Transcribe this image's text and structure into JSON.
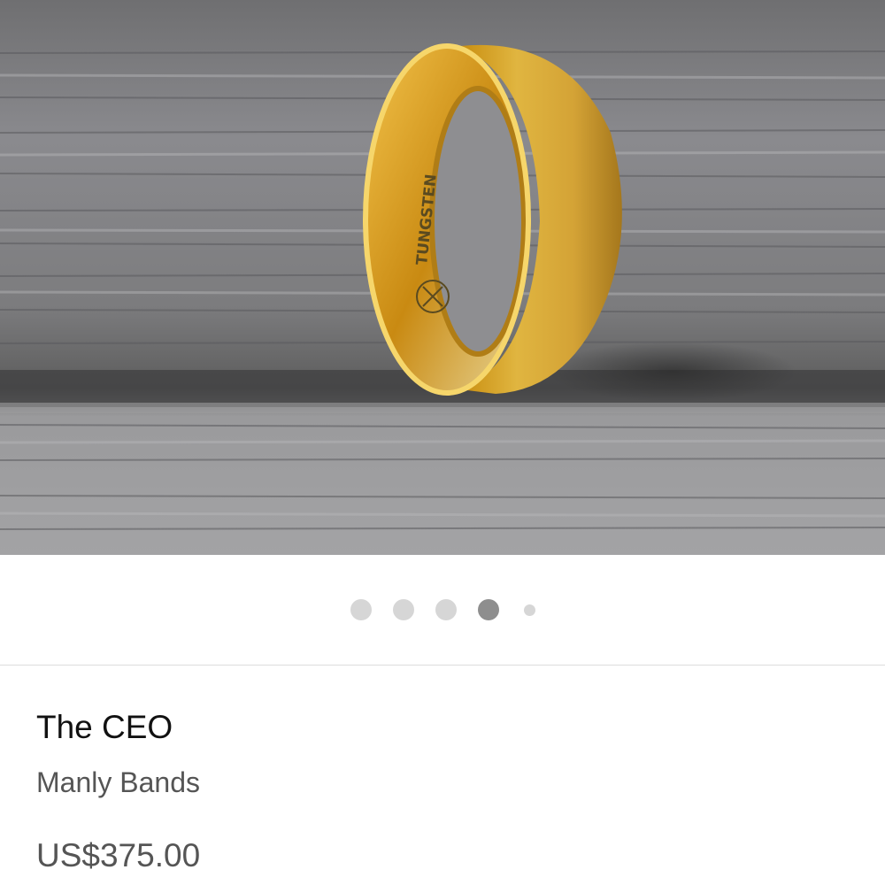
{
  "product": {
    "title": "The CEO",
    "brand": "Manly Bands",
    "price": "US$375.00",
    "image": {
      "engraving": "TUNGSTEN",
      "subject": "gold-ring-on-wood-icon"
    }
  },
  "carousel": {
    "total_pages": 5,
    "active_index": 3
  },
  "colors": {
    "gold": "#d4a52a",
    "wood": "#8d8d8d",
    "dot_inactive": "#d6d6d6",
    "dot_active": "#8e8e8e"
  }
}
